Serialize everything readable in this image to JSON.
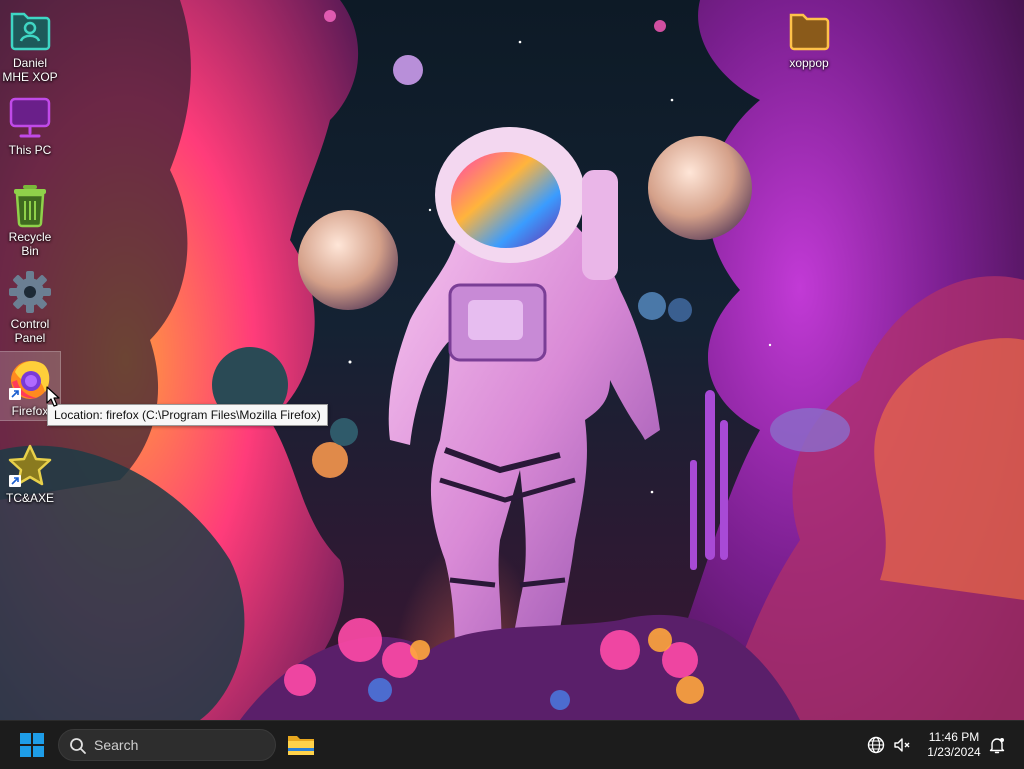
{
  "desktop": {
    "icons": [
      {
        "label": "Daniel MHE XOP",
        "icon": "user-folder-icon"
      },
      {
        "label": "This PC",
        "icon": "monitor-icon"
      },
      {
        "label": "Recycle Bin",
        "icon": "recycle-bin-icon"
      },
      {
        "label": "Control Panel",
        "icon": "gear-icon"
      },
      {
        "label": "Firefox",
        "icon": "firefox-icon"
      },
      {
        "label": "TC&AXE",
        "icon": "star-icon"
      },
      {
        "label": "xoppop",
        "icon": "folder-icon"
      }
    ],
    "tooltip": "Location: firefox (C:\\Program Files\\Mozilla Firefox)"
  },
  "taskbar": {
    "search_label": "Search",
    "time": "11:46 PM",
    "date": "1/23/2024",
    "accent": "#1e9de8"
  }
}
